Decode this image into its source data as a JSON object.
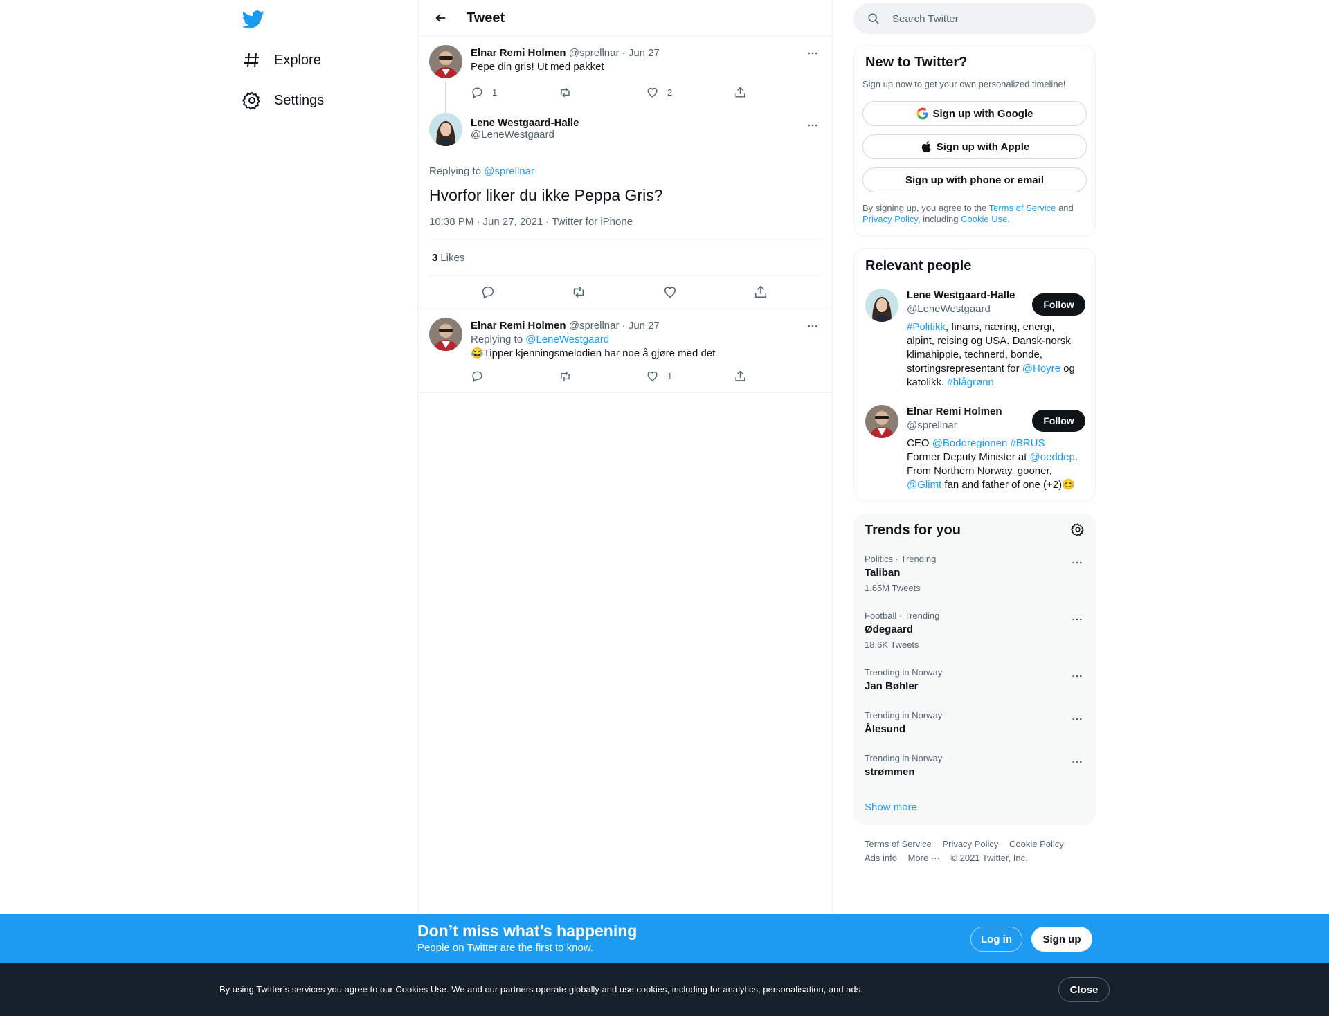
{
  "nav": {
    "logo_icon": "twitter-bird-icon",
    "items": [
      {
        "label": "Explore",
        "icon": "hashtag-icon"
      },
      {
        "label": "Settings",
        "icon": "gear-icon"
      }
    ]
  },
  "header": {
    "title": "Tweet"
  },
  "thread": {
    "parent": {
      "name": "Elnar Remi Holmen",
      "handle": "@sprellnar",
      "sep": "·",
      "date": "Jun 27",
      "text": "Pepe din gris! Ut med pakket",
      "replies": "1",
      "retweets": "",
      "likes": "2"
    },
    "focus": {
      "name": "Lene Westgaard-Halle",
      "handle": "@LeneWestgaard",
      "replying_label": "Replying to",
      "replying_to": "@sprellnar",
      "text": "Hvorfor liker du ikke Peppa Gris?",
      "meta": "10:38 PM · Jun 27, 2021 · Twitter for iPhone",
      "likes_count": "3",
      "likes_label": "Likes"
    },
    "reply": {
      "name": "Elnar Remi Holmen",
      "handle": "@sprellnar",
      "sep": "·",
      "date": "Jun 27",
      "replying_label": "Replying to",
      "replying_to": "@LeneWestgaard",
      "text": "😂Tipper kjenningsmelodien har noe å gjøre med det",
      "replies": "",
      "retweets": "",
      "likes": "1"
    }
  },
  "search": {
    "placeholder": "Search Twitter"
  },
  "new_to_twitter": {
    "title": "New to Twitter?",
    "subtitle": "Sign up now to get your own personalized timeline!",
    "google": "Sign up with Google",
    "apple": "Sign up with Apple",
    "phone": "Sign up with phone or email",
    "terms_1": "By signing up, you agree to the",
    "terms_link": "Terms of Service",
    "terms_2": "and",
    "privacy_link": "Privacy Policy",
    "terms_3": ", including",
    "cookie_link": "Cookie Use."
  },
  "relevant_people": {
    "title": "Relevant people",
    "follow_label": "Follow",
    "people": [
      {
        "name": "Lene Westgaard-Halle",
        "handle": "@LeneWestgaard",
        "bio": [
          {
            "t": "#Politikk",
            "link": true
          },
          {
            "t": ", finans, næring, energi, alpint, reising og USA. Dansk-norsk klimahippie, technerd, bonde, stortingsrepresentant for ",
            "link": false
          },
          {
            "t": "@Hoyre",
            "link": true
          },
          {
            "t": " og katolikk. ",
            "link": false
          },
          {
            "t": "#blågrønn",
            "link": true
          }
        ]
      },
      {
        "name": "Elnar Remi Holmen",
        "handle": "@sprellnar",
        "bio": [
          {
            "t": "CEO ",
            "link": false
          },
          {
            "t": "@Bodoregionen",
            "link": true
          },
          {
            "t": " ",
            "link": false
          },
          {
            "t": "#BRUS",
            "link": true
          },
          {
            "t": " Former Deputy Minister at ",
            "link": false
          },
          {
            "t": "@oeddep",
            "link": true
          },
          {
            "t": ". From Northern Norway, gooner, ",
            "link": false
          },
          {
            "t": "@Glimt",
            "link": true
          },
          {
            "t": " fan and father of one (+2)😊",
            "link": false
          }
        ]
      }
    ]
  },
  "trends": {
    "title": "Trends for you",
    "items": [
      {
        "meta": "Politics · Trending",
        "name": "Taliban",
        "count": "1.65M Tweets"
      },
      {
        "meta": "Football · Trending",
        "name": "Ødegaard",
        "count": "18.6K Tweets"
      },
      {
        "meta": "Trending in Norway",
        "name": "Jan Bøhler",
        "count": ""
      },
      {
        "meta": "Trending in Norway",
        "name": "Ålesund",
        "count": ""
      },
      {
        "meta": "Trending in Norway",
        "name": "strømmen",
        "count": ""
      }
    ],
    "show_more": "Show more"
  },
  "footer": {
    "terms": "Terms of Service",
    "privacy": "Privacy Policy",
    "cookie": "Cookie Policy",
    "ads": "Ads info",
    "more": "More ···",
    "copyright": "© 2021 Twitter, Inc."
  },
  "bottom_bar": {
    "title": "Don’t miss what’s happening",
    "subtitle": "People on Twitter are the first to know.",
    "login": "Log in",
    "signup": "Sign up"
  },
  "cookie_bar": {
    "text": "By using Twitter’s services you agree to our Cookies Use. We and our partners operate globally and use cookies, including for analytics, personalisation, and ads.",
    "close": "Close"
  },
  "colors": {
    "accent": "#1d9bf0",
    "text": "#0f1419",
    "secondary": "#536471",
    "cookie_bg": "#15202b"
  }
}
